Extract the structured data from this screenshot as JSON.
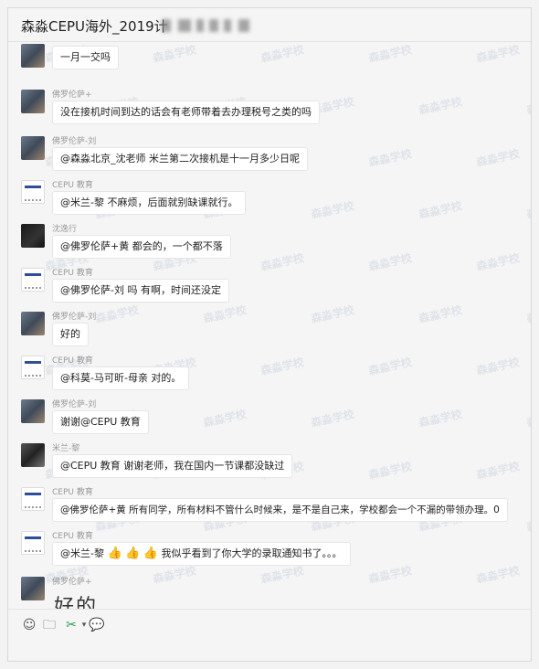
{
  "window": {
    "title": "森淼CEPU海外_2019计"
  },
  "watermark_text": "森淼学校",
  "messages": [
    {
      "id": "m1",
      "avatar": "photo",
      "name": "",
      "text": "一月一交吗"
    },
    {
      "id": "m2",
      "avatar": "photo",
      "name": "佛罗伦萨+",
      "text": "没在接机时间到达的话会有老师带着去办理税号之类的吗"
    },
    {
      "id": "m3",
      "avatar": "photo",
      "name": "佛罗伦萨-刘",
      "text": "@森淼北京_沈老师 米兰第二次接机是十一月多少日呢"
    },
    {
      "id": "m4",
      "avatar": "logo",
      "name": "CEPU 教育",
      "text": "@米兰-黎 不麻烦，后面就别缺课就行。"
    },
    {
      "id": "m5",
      "avatar": "dark",
      "name": "沈逸行",
      "text": "@佛罗伦萨+黄 都会的，一个都不落"
    },
    {
      "id": "m6",
      "avatar": "logo",
      "name": "CEPU 教育",
      "text": "@佛罗伦萨-刘 吗 有啊，时间还没定"
    },
    {
      "id": "m7",
      "avatar": "photo",
      "name": "佛罗伦萨-刘",
      "text": "好的"
    },
    {
      "id": "m8",
      "avatar": "logo",
      "name": "CEPU 教育",
      "text": "@科莫-马可昕-母亲 对的。"
    },
    {
      "id": "m9",
      "avatar": "photo",
      "name": "佛罗伦萨-刘",
      "text": "谢谢@CEPU 教育"
    },
    {
      "id": "m10",
      "avatar": "bike",
      "name": "米兰-黎",
      "text": "@CEPU 教育 谢谢老师，我在国内一节课都没缺过"
    },
    {
      "id": "m11",
      "avatar": "logo",
      "name": "CEPU 教育",
      "text": "@佛罗伦萨+黄 所有同学，所有材料不管什么时候来，是不是自己来，学校都会一个不漏的带领办理。0"
    },
    {
      "id": "m12",
      "avatar": "logo",
      "name": "CEPU 教育",
      "text": "@米兰-黎",
      "suffix": "我似乎看到了你大学的录取通知书了。。。"
    },
    {
      "id": "m13",
      "avatar": "photo",
      "name": "佛罗伦萨+",
      "text": ""
    }
  ],
  "partial_image_text": "好的",
  "toolbar": {
    "icons": [
      "emoji-icon",
      "folder-icon",
      "scissors-icon",
      "chat-bubble-icon"
    ]
  },
  "colors": {
    "window_bg": "#f5f5f5",
    "bubble_bg": "#ffffff",
    "name_text": "#9a9a9a",
    "watermark": "#b9c4d6"
  }
}
